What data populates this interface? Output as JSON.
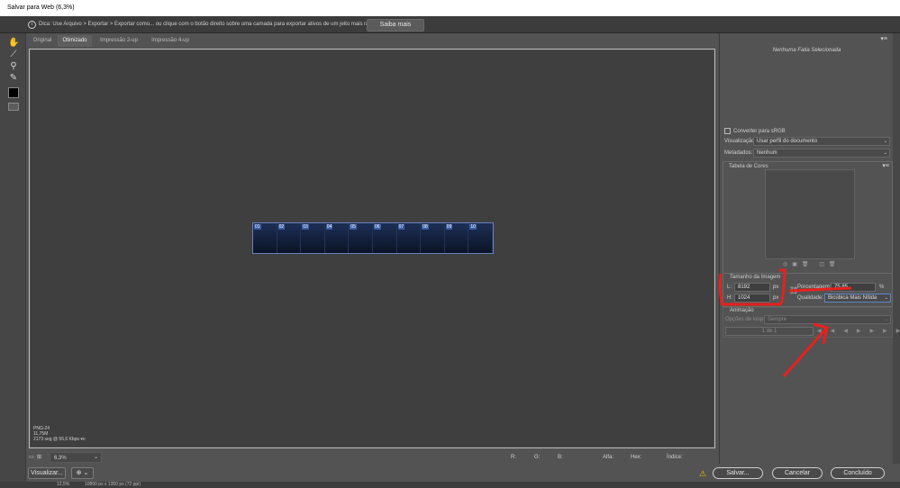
{
  "window": {
    "title": "Salvar para Web (6,3%)"
  },
  "tip": {
    "text": "Dica: Use Arquivo > Exportar > Exportar como... ou clique com o botão direito sobre uma camada para exportar ativos de um jeito mais rápido",
    "learn_more": "Saiba mais"
  },
  "tabs": [
    "Original",
    "Otimizado",
    "Impressão 2-up",
    "Impressão 4-up"
  ],
  "slices": [
    "01",
    "02",
    "03",
    "04",
    "05",
    "06",
    "07",
    "08",
    "09",
    "10"
  ],
  "canvas_info": {
    "format": "PNG-24",
    "size": "11,75M",
    "time": "2173 seg @ 56,6 Kbps"
  },
  "status": {
    "zoom": "6,3%",
    "r": "R:",
    "g": "G:",
    "b": "B:",
    "alpha": "Alfa:",
    "hex": "Hex:",
    "index": "Índice:"
  },
  "buttons": {
    "preview": "Visualizar...",
    "save": "Salvar...",
    "cancel": "Cancelar",
    "done": "Concluído"
  },
  "bottom": {
    "zoom": "12,5%",
    "doc": "10800 px x 1350 px (72 ppi)"
  },
  "panel": {
    "no_slice": "Nenhuma Fatia Selecionada",
    "convert_srgb": "Converter para sRGB",
    "preview_label": "Visualização:",
    "preview_value": "Usar perfil do documento",
    "metadata_label": "Metadados:",
    "metadata_value": "Nenhum",
    "color_table": "Tabela de Cores",
    "image_size": "Tamanho da Imagem",
    "width_label": "L:",
    "width_value": "8192",
    "height_label": "H:",
    "height_value": "1024",
    "px": "px",
    "percent_label": "Porcentagem:",
    "percent_value": "75,85",
    "percent_unit": "%",
    "quality_label": "Qualidade:",
    "quality_value": "Bicúbica Mais Nítida",
    "animation": "Animação",
    "loop_label": "Opções de loop:",
    "loop_value": "Sempre",
    "frame": "1 de 1"
  },
  "colors": {
    "annotation": "#e8211d"
  }
}
